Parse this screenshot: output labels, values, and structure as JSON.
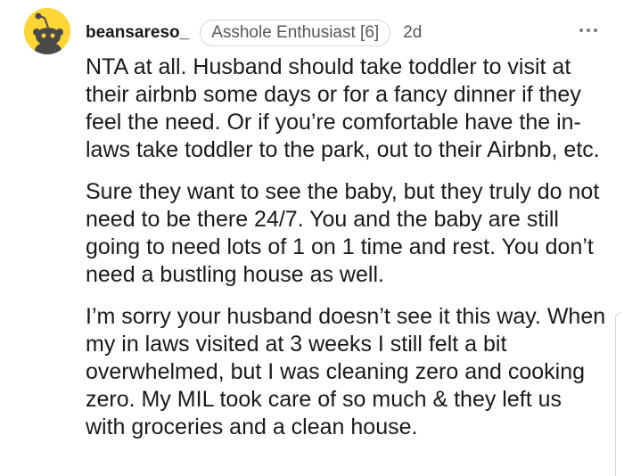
{
  "comment": {
    "username": "beansareso_",
    "flair": "Asshole Enthusiast [6]",
    "timestamp": "2d",
    "more_icon": "more-horizontal-icon",
    "avatar_icon": "snoo-avatar-icon",
    "paragraphs": [
      "NTA at all. Husband should take toddler to visit at their airbnb some days or for a fancy dinner if they feel the need. Or if you’re comfortable have the in-laws take toddler to the park, out to their Airbnb, etc.",
      "Sure they want to see the baby, but they truly do not need to be there 24/7. You and the baby are still going to need lots of 1 on 1 time and rest. You don’t need a bustling house as well.",
      "I’m sorry your husband doesn’t see it this way. When my in laws visited at 3 weeks I still felt a bit overwhelmed, but I was cleaning zero and cooking zero. My MIL took care of so much & they left us with groceries and a clean house."
    ]
  },
  "colors": {
    "avatar_bg": "#ffd635",
    "text": "#1a1a1b",
    "meta_text": "#56585a",
    "flair_border": "#d6d7d9"
  }
}
